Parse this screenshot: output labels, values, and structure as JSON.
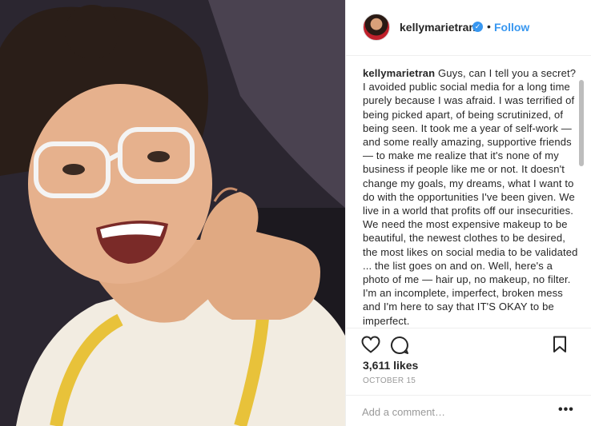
{
  "post": {
    "photo_alt": "selfie photo",
    "username": "kellymarietran",
    "verified": true,
    "follow_label": "Follow",
    "separator": "•",
    "caption_user": "kellymarietran",
    "caption_text": "Guys, can I tell you a secret? I avoided public social media for a long time purely because I was afraid. I was terrified of being picked apart, of being scrutinized, of being seen. It took me a year of self-work — and some really amazing, supportive friends — to make me realize that it's none of my business if people like me or not. It doesn't change my goals, my dreams, what I want to do with the opportunities I've been given. We live in a world that profits off our insecurities. We need the most expensive makeup to be beautiful, the newest clothes to be desired, the most likes on social media to be validated ... the list goes on and on. Well, here's a photo of me — hair up, no makeup, no filter. I'm an incomplete, imperfect, broken mess and I'm here to say that IT'S OKAY to be imperfect.",
    "likes": "3,611 likes",
    "date": "OCTOBER 15",
    "comment_placeholder": "Add a comment…",
    "more_label": "•••"
  },
  "icons": {
    "like": "heart-icon",
    "comment": "speech-bubble-icon",
    "save": "bookmark-icon",
    "verified": "verified-badge-icon"
  },
  "colors": {
    "accent": "#3897f0",
    "text": "#262626",
    "muted": "#999999"
  }
}
